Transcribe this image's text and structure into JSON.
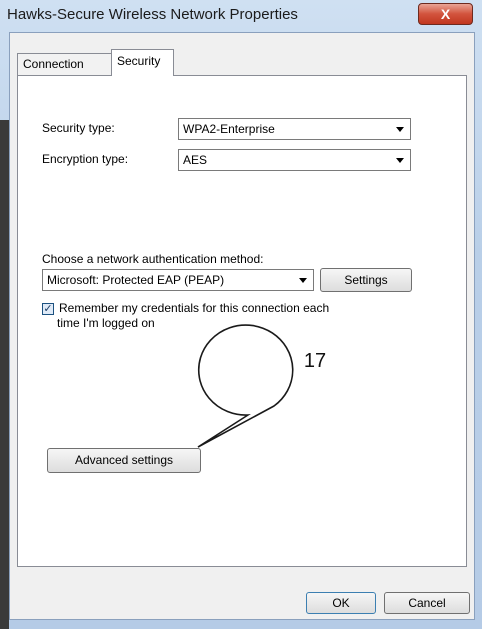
{
  "window": {
    "title": "Hawks-Secure Wireless Network Properties",
    "close_symbol": "X"
  },
  "tabs": [
    {
      "label": "Connection",
      "selected": false
    },
    {
      "label": "Security",
      "selected": true
    }
  ],
  "security": {
    "security_type_label": "Security type:",
    "security_type_value": "WPA2-Enterprise",
    "encryption_type_label": "Encryption type:",
    "encryption_type_value": "AES",
    "auth_method_label": "Choose a network authentication method:",
    "auth_method_value": "Microsoft: Protected EAP (PEAP)",
    "settings_button": "Settings",
    "remember_checkbox": {
      "checked": true,
      "line1": "Remember my credentials for this connection each",
      "line2": "time I'm logged on"
    },
    "advanced_button": "Advanced settings"
  },
  "footer": {
    "ok": "OK",
    "cancel": "Cancel"
  },
  "callout": {
    "number": "17"
  }
}
